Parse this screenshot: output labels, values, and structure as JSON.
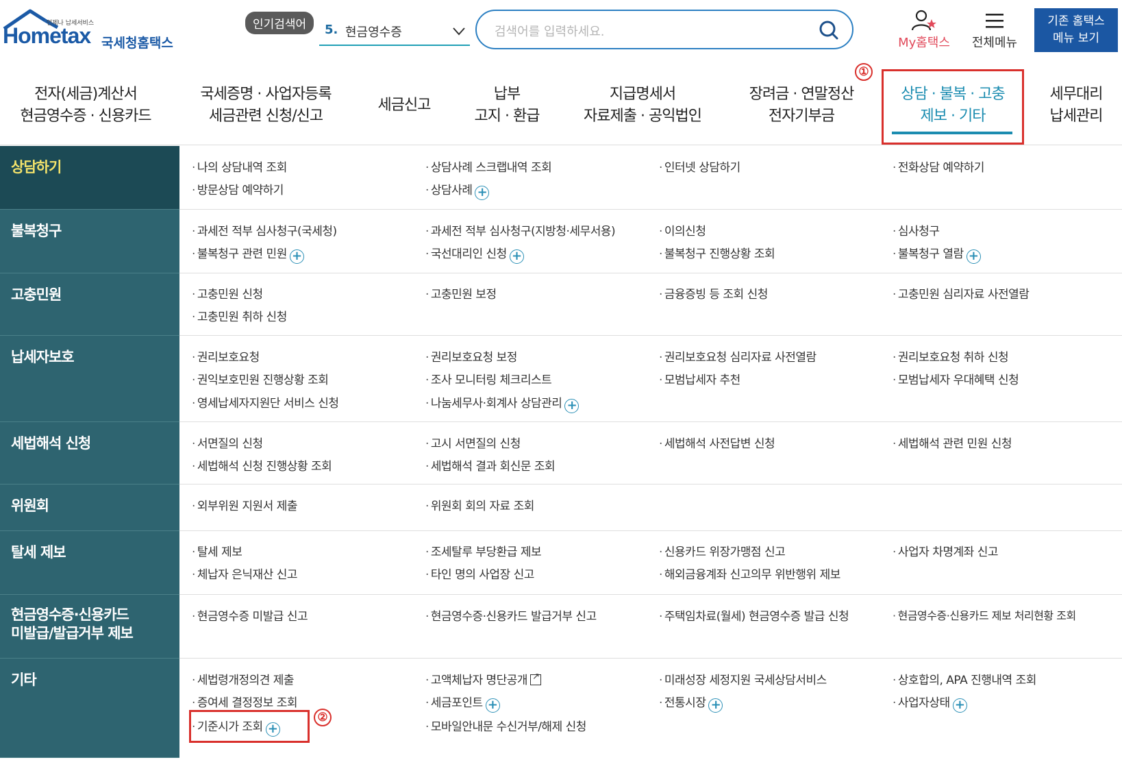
{
  "header": {
    "logo_tagline": "언제나 납세서비스",
    "logo_text": "Hometax",
    "logo_korean": "국세청홈택스",
    "popular_label": "인기검색어",
    "popular_number": "5.",
    "popular_term": "현금영수증",
    "search_placeholder": "검색어를 입력하세요.",
    "my_hometax": "My홈택스",
    "all_menu": "전체메뉴",
    "old_home_line1": "기존 홈택스",
    "old_home_line2": "메뉴 보기"
  },
  "gnb": [
    {
      "line1": "전자(세금)계산서",
      "line2": "현금영수증 · 신용카드"
    },
    {
      "line1": "국세증명 · 사업자등록",
      "line2": "세금관련 신청/신고"
    },
    {
      "line1": "세금신고",
      "line2": ""
    },
    {
      "line1": "납부",
      "line2": "고지 · 환급"
    },
    {
      "line1": "지급명세서",
      "line2": "자료제출 · 공익법인"
    },
    {
      "line1": "장려금 · 연말정산",
      "line2": "전자기부금"
    },
    {
      "line1": "상담 · 불복 · 고충",
      "line2": "제보 · 기타"
    },
    {
      "line1": "세무대리",
      "line2": "납세관리"
    }
  ],
  "annotations": {
    "one": "①",
    "two": "②"
  },
  "accent_colors": {
    "teal": "#2e6470",
    "active": "#1c4a55",
    "highlight": "#f4e36b",
    "red": "#d9302c",
    "link_blue": "#1b8cb0"
  },
  "sections": [
    {
      "title": "상담하기",
      "items": [
        {
          "text": "나의 상담내역 조회"
        },
        {
          "text": "상담사례 스크랩내역 조회"
        },
        {
          "text": "인터넷 상담하기"
        },
        {
          "text": "전화상담 예약하기"
        },
        {
          "text": "방문상담 예약하기"
        },
        {
          "text": "상담사례",
          "plus": "+"
        }
      ]
    },
    {
      "title": "불복청구",
      "items": [
        {
          "text": "과세전 적부 심사청구(국세청)"
        },
        {
          "text": "과세전 적부 심사청구(지방청·세무서용)"
        },
        {
          "text": "이의신청"
        },
        {
          "text": "심사청구"
        },
        {
          "text": "불복청구 관련 민원",
          "plus": "+"
        },
        {
          "text": "국선대리인 신청",
          "plus": "+"
        },
        {
          "text": "불복청구 진행상황 조회"
        },
        {
          "text": "불복청구 열람",
          "plus": "+"
        }
      ]
    },
    {
      "title": "고충민원",
      "items": [
        {
          "text": "고충민원 신청"
        },
        {
          "text": "고충민원 보정"
        },
        {
          "text": "금융증빙 등 조회 신청"
        },
        {
          "text": "고충민원 심리자료 사전열람"
        },
        {
          "text": "고충민원 취하 신청"
        }
      ]
    },
    {
      "title": "납세자보호",
      "items": [
        {
          "text": "권리보호요청"
        },
        {
          "text": "권리보호요청 보정"
        },
        {
          "text": "권리보호요청 심리자료 사전열람"
        },
        {
          "text": "권리보호요청 취하 신청"
        },
        {
          "text": "권익보호민원 진행상황 조회"
        },
        {
          "text": "조사 모니터링 체크리스트"
        },
        {
          "text": "모범납세자 추천"
        },
        {
          "text": "모범납세자 우대혜택 신청"
        },
        {
          "text": "영세납세자지원단 서비스 신청"
        },
        {
          "text": "나눔세무사·회계사 상담관리",
          "plus": "+"
        }
      ]
    },
    {
      "title": "세법해석 신청",
      "items": [
        {
          "text": "서면질의 신청"
        },
        {
          "text": "고시 서면질의 신청"
        },
        {
          "text": "세법해석 사전답변 신청"
        },
        {
          "text": "세법해석 관련 민원 신청"
        },
        {
          "text": "세법해석 신청 진행상황 조회"
        },
        {
          "text": "세법해석 결과 회신문 조회"
        }
      ]
    },
    {
      "title": "위원회",
      "items": [
        {
          "text": "외부위원 지원서 제출"
        },
        {
          "text": "위원회 회의 자료 조회"
        }
      ]
    },
    {
      "title": "탈세 제보",
      "items": [
        {
          "text": "탈세 제보"
        },
        {
          "text": "조세탈루 부당환급 제보"
        },
        {
          "text": "신용카드 위장가맹점 신고"
        },
        {
          "text": "사업자 차명계좌 신고"
        },
        {
          "text": "체납자 은닉재산 신고"
        },
        {
          "text": "타인 명의 사업장 신고"
        },
        {
          "text": "해외금융계좌 신고의무 위반행위 제보"
        }
      ]
    },
    {
      "title": "현금영수증·신용카드\n미발급/발급거부 제보",
      "title1": "현금영수증·신용카드",
      "title2": "미발급/발급거부 제보",
      "items": [
        {
          "text": "현금영수증 미발급 신고"
        },
        {
          "text": "현금영수증·신용카드 발급거부 신고"
        },
        {
          "text": "주택임차료(월세) 현금영수증 발급 신청"
        },
        {
          "text": "현금영수증·신용카드 제보 처리현황 조회"
        }
      ]
    },
    {
      "title": "기타",
      "items": [
        {
          "text": "세법령개정의견 제출"
        },
        {
          "text": "고액체납자 명단공개",
          "ext": true
        },
        {
          "text": "미래성장 세정지원 국세상담서비스"
        },
        {
          "text": "상호합의, APA 진행내역 조회"
        },
        {
          "text": "증여세 결정정보 조회"
        },
        {
          "text": "세금포인트",
          "plus": "+"
        },
        {
          "text": "전통시장",
          "plus": "+"
        },
        {
          "text": "사업자상태",
          "plus": "+"
        },
        {
          "text": "기준시가 조회",
          "plus": "+"
        },
        {
          "text": "모바일안내문 수신거부/해제 신청"
        }
      ]
    }
  ]
}
